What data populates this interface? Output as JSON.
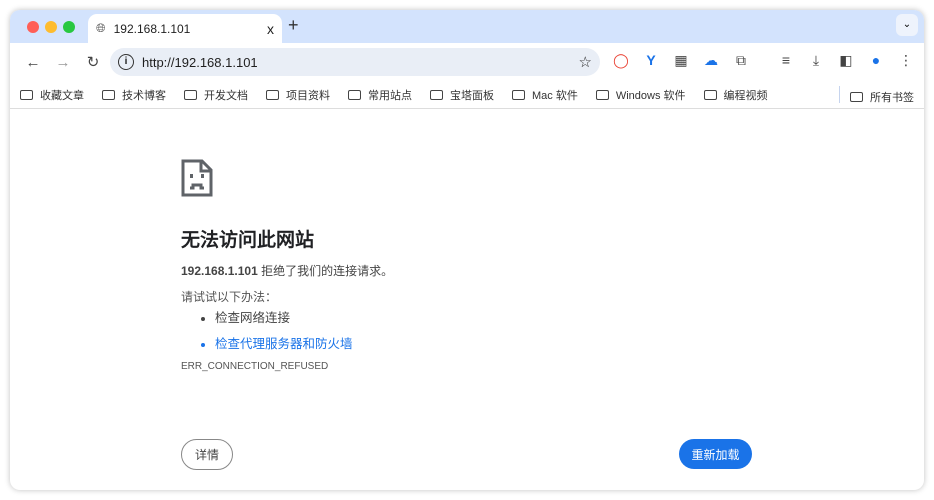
{
  "tab": {
    "title": "192.168.1.101",
    "close": "x",
    "new_tab": "+",
    "menu": "⌄"
  },
  "toolbar": {
    "url": "http://192.168.1.101",
    "back": "←",
    "forward": "→",
    "reload": "↻",
    "star": "☆"
  },
  "bookmarks": [
    "收藏文章",
    "技术博客",
    "开发文档",
    "项目资料",
    "常用站点",
    "宝塔面板",
    "Mac 软件",
    "Windows 软件",
    "编程视频"
  ],
  "all_bookmarks": "所有书签",
  "error": {
    "title": "无法访问此网站",
    "host": "192.168.1.101",
    "message": " 拒绝了我们的连接请求。",
    "try_label": "请试试以下办法：",
    "suggestions": [
      "检查网络连接",
      "检查代理服务器和防火墙"
    ],
    "code": "ERR_CONNECTION_REFUSED",
    "details_button": "详情",
    "reload_button": "重新加载"
  },
  "colors": {
    "accent": "#1a73e8",
    "tabbar": "#d3e3fd"
  }
}
